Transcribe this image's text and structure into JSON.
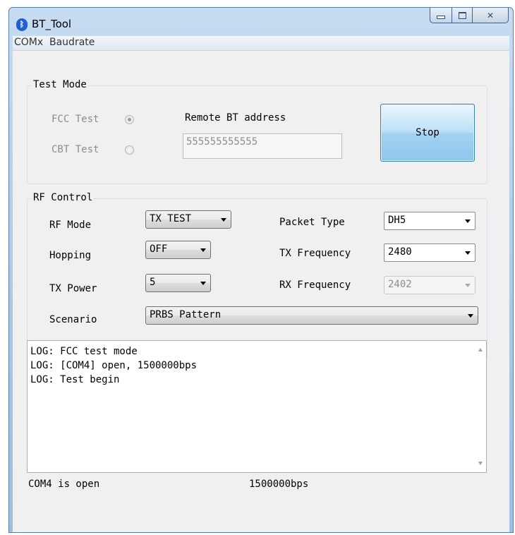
{
  "window": {
    "title": "BT_Tool"
  },
  "menu": {
    "items": [
      "COMx",
      "Baudrate"
    ]
  },
  "test_mode": {
    "title": "Test Mode",
    "fcc_label": "FCC Test",
    "cbt_label": "CBT Test",
    "remote_label": "Remote BT address",
    "remote_value": "555555555555",
    "stop_label": "Stop"
  },
  "rf_control": {
    "title": "RF Control",
    "rf_mode_label": "RF Mode",
    "rf_mode_value": "TX TEST",
    "hopping_label": "Hopping",
    "hopping_value": "OFF",
    "tx_power_label": "TX Power",
    "tx_power_value": "5",
    "scenario_label": "Scenario",
    "scenario_value": "PRBS Pattern",
    "packet_type_label": "Packet Type",
    "packet_type_value": "DH5",
    "tx_freq_label": "TX Frequency",
    "tx_freq_value": "2480",
    "rx_freq_label": "RX Frequency",
    "rx_freq_value": "2402"
  },
  "log": {
    "lines": [
      "LOG: FCC test mode",
      "LOG: [COM4] open, 1500000bps",
      "LOG: Test begin"
    ]
  },
  "status": {
    "port": "COM4 is open",
    "baud": "1500000bps"
  }
}
